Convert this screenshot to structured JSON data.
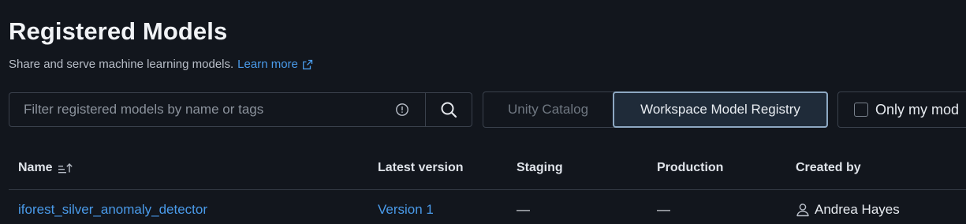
{
  "header": {
    "title": "Registered Models",
    "subtitle": "Share and serve machine learning models.",
    "learn_more": "Learn more"
  },
  "search": {
    "placeholder": "Filter registered models by name or tags",
    "value": ""
  },
  "registry_toggle": {
    "options": [
      "Unity Catalog",
      "Workspace Model Registry"
    ],
    "selected": "Workspace Model Registry"
  },
  "filter": {
    "only_mine_label": "Only my mod",
    "checked": false
  },
  "table": {
    "columns": [
      "Name",
      "Latest version",
      "Staging",
      "Production",
      "Created by"
    ],
    "rows": [
      {
        "name": "iforest_silver_anomaly_detector",
        "latest_version": "Version 1",
        "staging": "—",
        "production": "—",
        "created_by": "Andrea Hayes"
      }
    ]
  },
  "colors": {
    "background": "#12161d",
    "link": "#4a9bea",
    "selected_segment_border": "#8da8c2"
  },
  "icons": {
    "external_link": "external-link-icon",
    "info": "info-icon",
    "search": "search-icon",
    "sort": "sort-ascending-icon",
    "user": "user-icon"
  }
}
